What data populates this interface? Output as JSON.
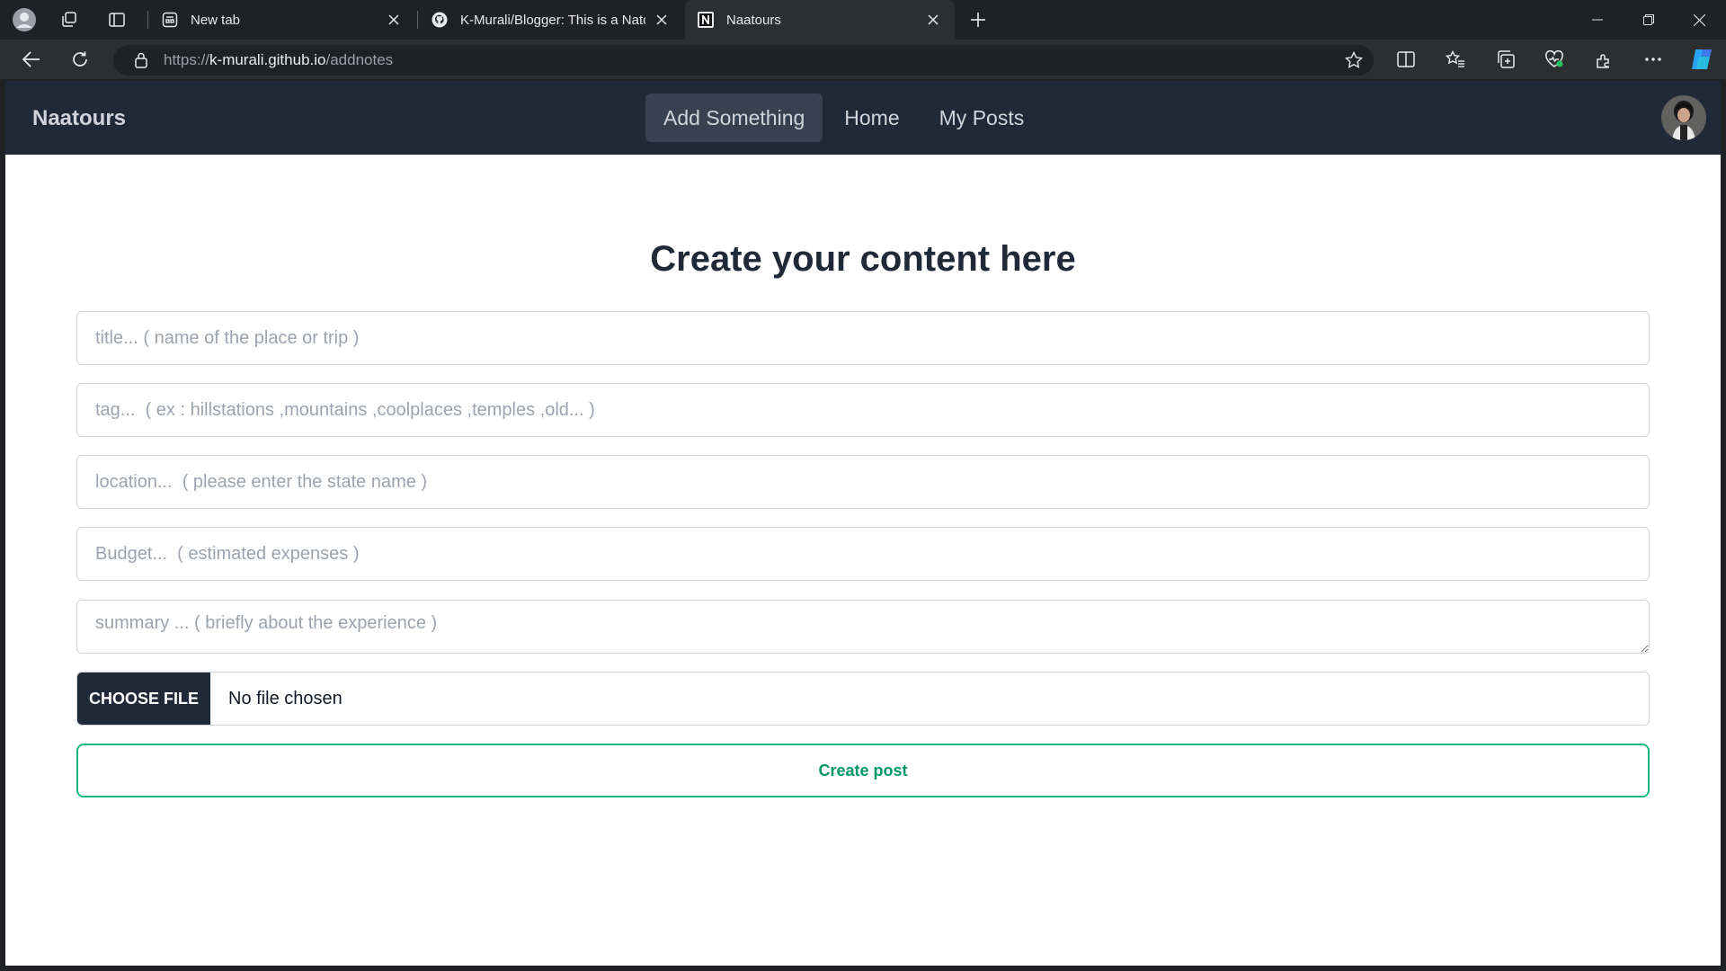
{
  "browser": {
    "tabs": [
      {
        "title": "New tab",
        "favicon": "new-tab-icon"
      },
      {
        "title": "K-Murali/Blogger: This is a Natou",
        "favicon": "github-icon"
      },
      {
        "title": "Naatours",
        "favicon": "naatours-n-icon"
      }
    ],
    "url": {
      "scheme": "https://",
      "host": "k-murali.github.io",
      "path": "/addnotes"
    }
  },
  "navbar": {
    "brand": "Naatours",
    "links": [
      "Add Something",
      "Home",
      "My Posts"
    ],
    "active_link": "Add Something"
  },
  "form": {
    "heading": "Create your content here",
    "title_placeholder": "title... ( name of the place or trip )",
    "tag_placeholder": "tag...  ( ex : hillstations ,mountains ,coolplaces ,temples ,old... )",
    "location_placeholder": "location...  ( please enter the state name )",
    "budget_placeholder": "Budget...  ( estimated expenses )",
    "summary_placeholder": "summary ... ( briefly about the experience )",
    "file_button": "CHOOSE FILE",
    "file_status": "No file chosen",
    "submit_label": "Create post"
  },
  "colors": {
    "navbar_bg": "#1f2937",
    "accent_green": "#10b981",
    "browser_bg": "#202124"
  }
}
